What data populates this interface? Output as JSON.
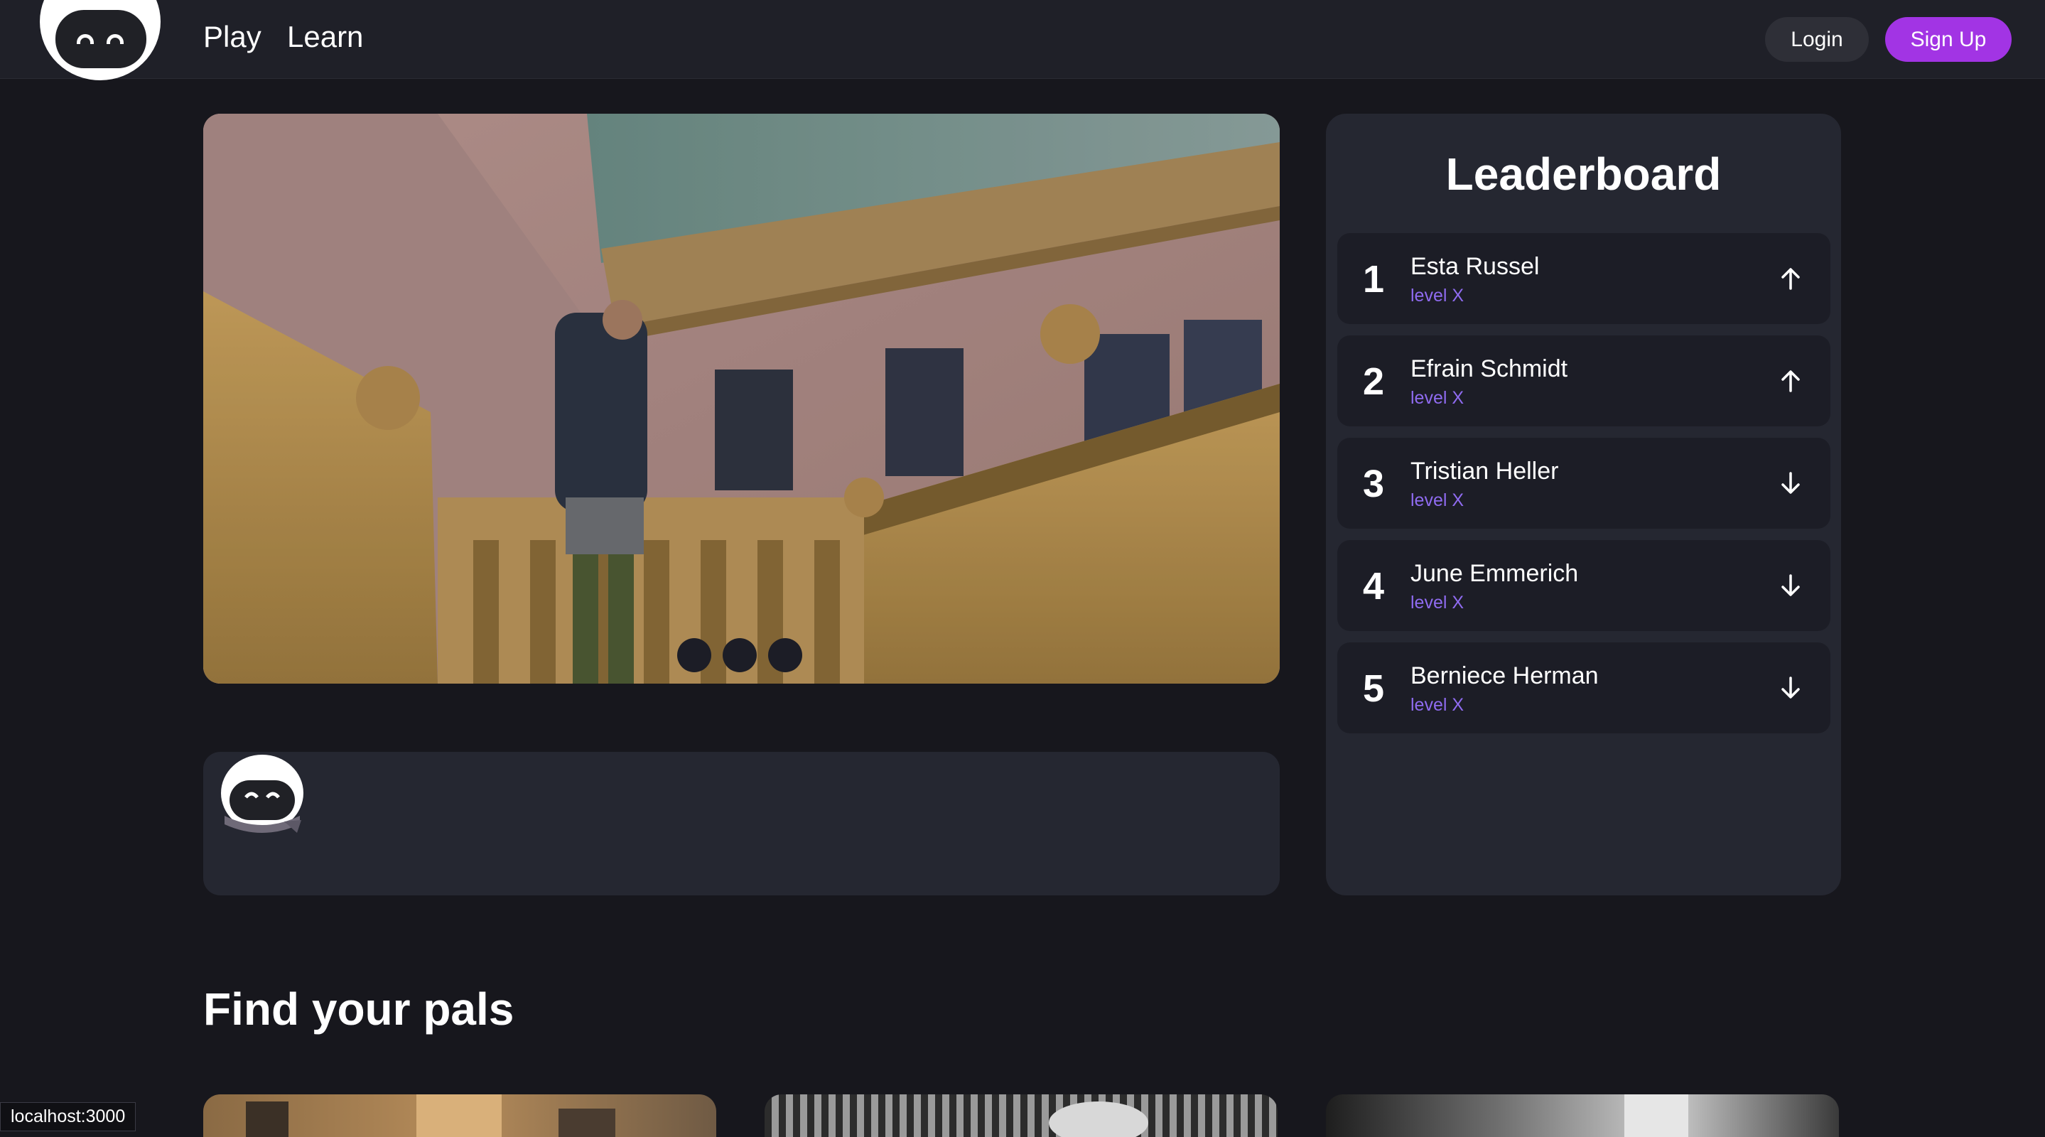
{
  "nav": {
    "links": [
      "Play",
      "Learn"
    ],
    "login_label": "Login",
    "signup_label": "Sign Up"
  },
  "colors": {
    "background": "#17171d",
    "card": "#252731",
    "row": "#1c1d26",
    "accent": "#a234e4",
    "level_text": "#8f6bf0"
  },
  "hero": {
    "slides": 3
  },
  "leaderboard": {
    "title": "Leaderboard",
    "entries": [
      {
        "rank": "1",
        "name": "Esta Russel",
        "level": "level X",
        "trend": "up"
      },
      {
        "rank": "2",
        "name": "Efrain Schmidt",
        "level": "level X",
        "trend": "up"
      },
      {
        "rank": "3",
        "name": "Tristian Heller",
        "level": "level X",
        "trend": "down"
      },
      {
        "rank": "4",
        "name": "June Emmerich",
        "level": "level X",
        "trend": "down"
      },
      {
        "rank": "5",
        "name": "Berniece Herman",
        "level": "level X",
        "trend": "down"
      }
    ]
  },
  "pals": {
    "title": "Find your pals"
  },
  "status_bar": "localhost:3000"
}
